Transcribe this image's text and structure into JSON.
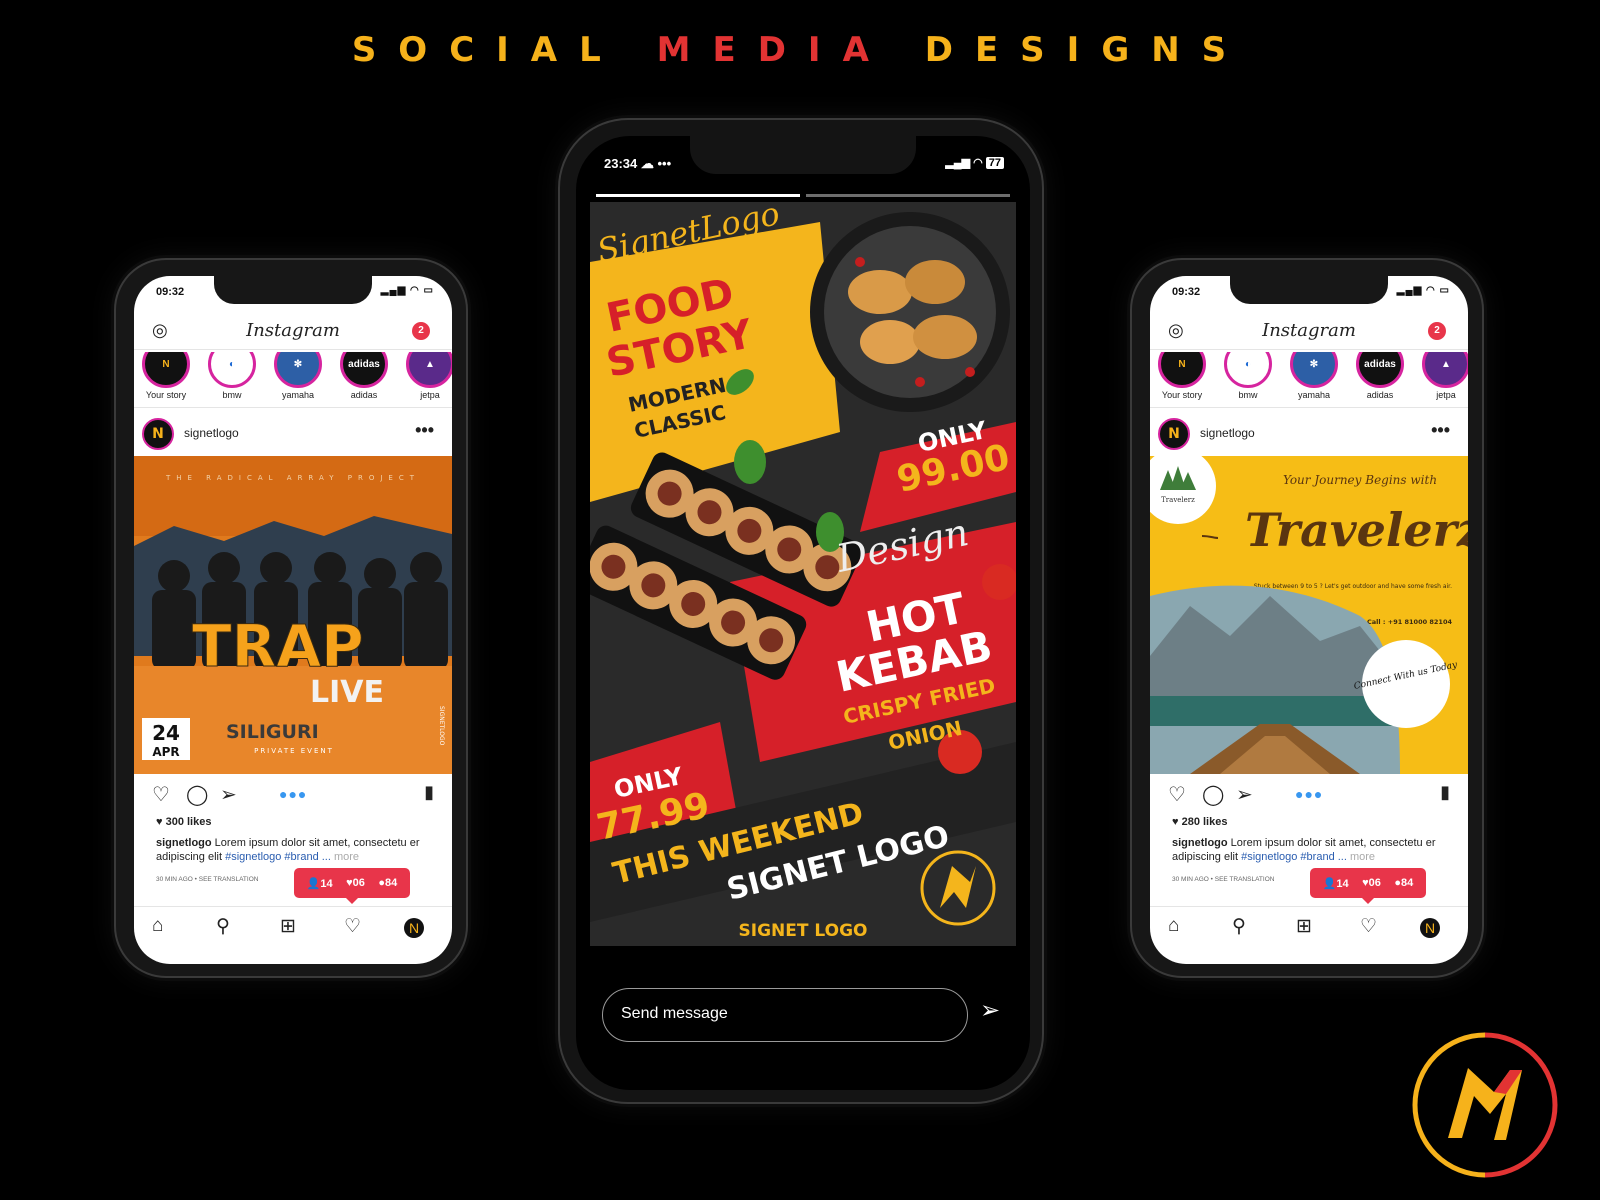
{
  "title": {
    "part1": "SOCIAL",
    "part2": "MEDIA",
    "part3": "DESIGNS"
  },
  "colors": {
    "accent_yellow": "#f6b21b",
    "accent_red": "#e23333",
    "instagram_red": "#e8354a",
    "link_blue": "#2a5db0"
  },
  "left_phone": {
    "status_time": "09:32",
    "app_name": "Instagram",
    "notification_count": "2",
    "stories": [
      {
        "label": "Your story",
        "icon": "signet-logo"
      },
      {
        "label": "bmw",
        "icon": "bmw-logo"
      },
      {
        "label": "yamaha",
        "icon": "yamaha-logo"
      },
      {
        "label": "adidas",
        "icon": "adidas-logo"
      },
      {
        "label": "jetpa",
        "icon": "jetpa-logo"
      }
    ],
    "username": "signetlogo",
    "post": {
      "top_text": "THE RADICAL ARRAY PROJECT",
      "title": "TRAP",
      "subtitle": "LIVE",
      "city": "SILIGURI",
      "event": "PRIVATE EVENT",
      "day": "24",
      "month": "APR",
      "side": "SIGNETLOGO"
    },
    "likes": "300 likes",
    "caption": {
      "user": "signetlogo",
      "text": "Lorem ipsum dolor sit amet, consectetu er adipiscing elit",
      "tags": "#signetlogo #brand ...",
      "more": "more"
    },
    "time_ago": "30 MIN AGO • SEE TRANSLATION",
    "notif": {
      "followers": "14",
      "likes": "06",
      "comments": "84"
    }
  },
  "center_phone": {
    "status_time": "23:34",
    "battery": "77",
    "story": {
      "brand": "SignetLogo",
      "headline1": "FOOD",
      "headline2": "STORY",
      "sub1": "MODERN",
      "sub2": "CLASSIC",
      "only_label": "ONLY",
      "price1": "99.00",
      "design": "Design",
      "dish1": "HOT",
      "dish2": "KEBAB",
      "dish_sub1": "CRISPY FRIED",
      "dish_sub2": "ONION",
      "price2": "77.99",
      "weekend1": "THIS WEEKEND",
      "weekend2": "SIGNET LOGO",
      "footer": "SIGNET LOGO"
    },
    "send_placeholder": "Send message"
  },
  "right_phone": {
    "status_time": "09:32",
    "app_name": "Instagram",
    "notification_count": "2",
    "stories": [
      {
        "label": "Your story",
        "icon": "signet-logo"
      },
      {
        "label": "bmw",
        "icon": "bmw-logo"
      },
      {
        "label": "yamaha",
        "icon": "yamaha-logo"
      },
      {
        "label": "adidas",
        "icon": "adidas-logo"
      },
      {
        "label": "jetpa",
        "icon": "jetpa-logo"
      }
    ],
    "username": "signetlogo",
    "post": {
      "brand_small": "Travelerz",
      "tagline": "Your Journey Begins with",
      "title": "Travelerz",
      "text": "Stuck between 9 to 5 ? Let's get outdoor and have some fresh air.",
      "call": "Call : +91 81000 82104",
      "badge": "Connect With us Today"
    },
    "likes": "280 likes",
    "caption": {
      "user": "signetlogo",
      "text": "Lorem ipsum dolor sit amet, consectetu er adipiscing elit",
      "tags": "#signetlogo #brand ...",
      "more": "more"
    },
    "time_ago": "30 MIN AGO • SEE TRANSLATION",
    "notif": {
      "followers": "14",
      "likes": "06",
      "comments": "84"
    }
  }
}
